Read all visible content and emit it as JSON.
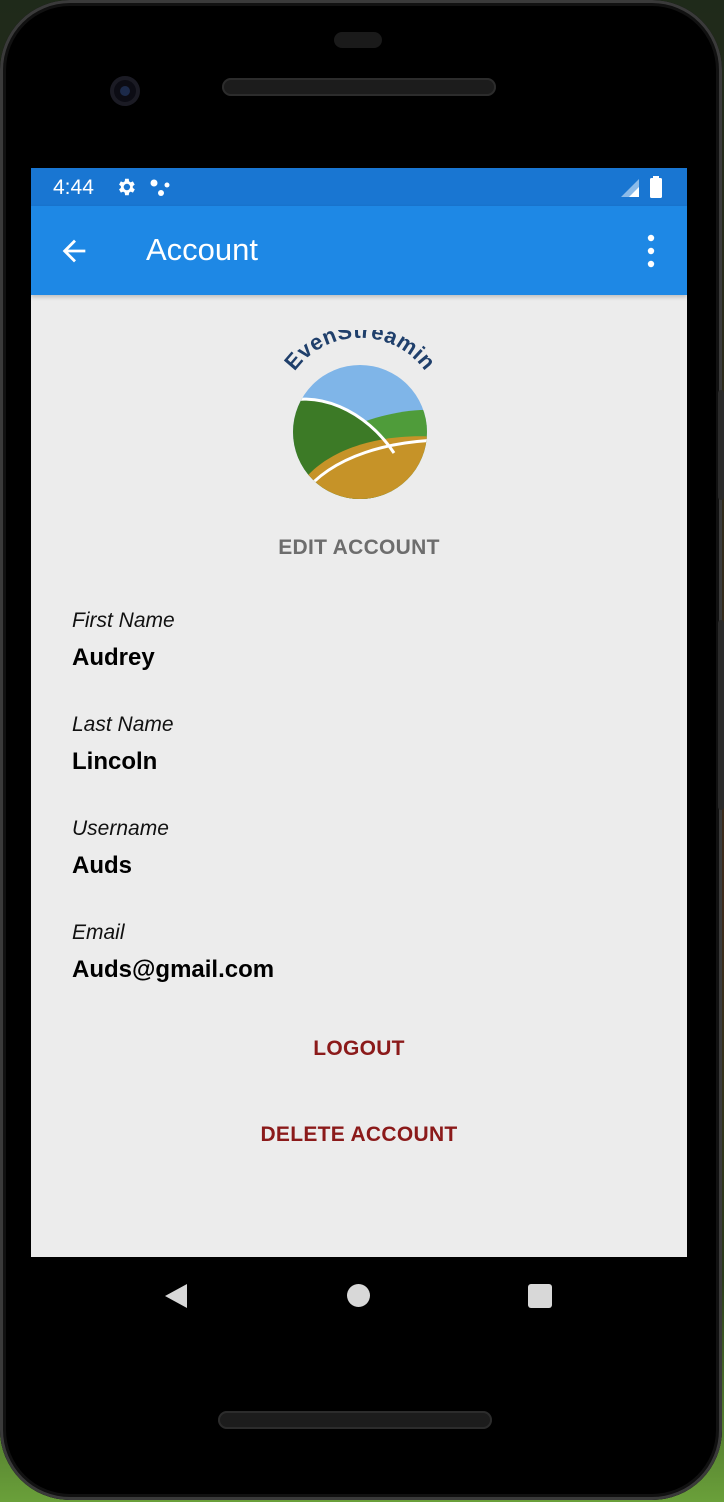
{
  "status_bar": {
    "time": "4:44",
    "icons": [
      "gear-icon",
      "dots-icon",
      "signal-icon",
      "battery-icon"
    ]
  },
  "app_bar": {
    "title": "Account",
    "back_icon": "arrow-left-icon",
    "menu_icon": "more-vert-icon",
    "color": "#1e88e5"
  },
  "logo": {
    "text": "EvenStreamin"
  },
  "edit_account_label": "EDIT ACCOUNT",
  "fields": [
    {
      "label": "First Name",
      "value": "Audrey"
    },
    {
      "label": "Last Name",
      "value": "Lincoln"
    },
    {
      "label": "Username",
      "value": "Auds"
    },
    {
      "label": "Email",
      "value": "Auds@gmail.com"
    }
  ],
  "actions": {
    "logout": "LOGOUT",
    "delete_account": "DELETE ACCOUNT",
    "color": "#8b1a1a"
  },
  "nav_bar": {
    "icons": [
      "nav-back-icon",
      "nav-home-icon",
      "nav-recents-icon"
    ]
  }
}
